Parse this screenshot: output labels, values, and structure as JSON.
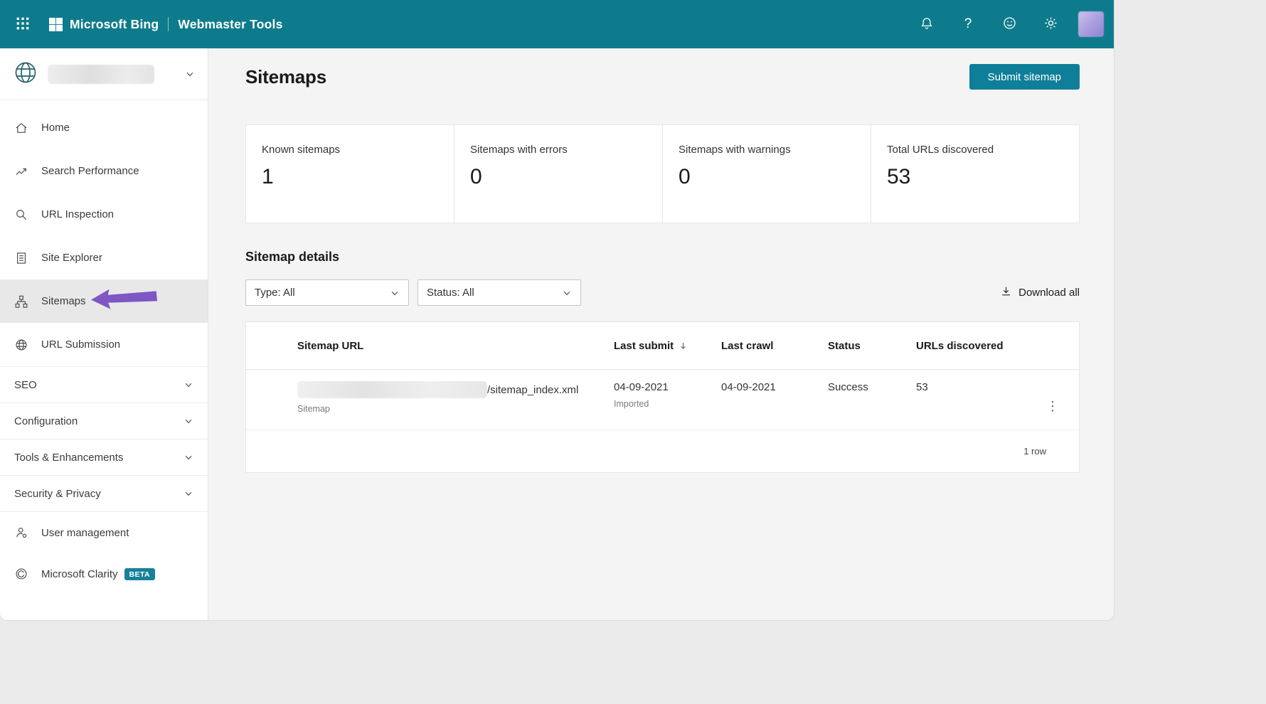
{
  "colors": {
    "accent": "#0e7b8c",
    "button": "#0f7f99",
    "badge": "#17809b",
    "arrow": "#7e57c5"
  },
  "topbar": {
    "brand": "Microsoft Bing",
    "product": "Webmaster Tools",
    "icons": {
      "help": "?"
    }
  },
  "sidebar": {
    "items": [
      {
        "label": "Home"
      },
      {
        "label": "Search Performance"
      },
      {
        "label": "URL Inspection"
      },
      {
        "label": "Site Explorer"
      },
      {
        "label": "Sitemaps",
        "selected": true
      },
      {
        "label": "URL Submission"
      },
      {
        "label": "SEO"
      },
      {
        "label": "Configuration"
      },
      {
        "label": "Tools & Enhancements"
      },
      {
        "label": "Security & Privacy"
      },
      {
        "label": "User management"
      },
      {
        "label": "Microsoft Clarity",
        "badge": "BETA"
      }
    ]
  },
  "main": {
    "title": "Sitemaps",
    "submit_button": "Submit sitemap",
    "stats": [
      {
        "label": "Known sitemaps",
        "value": "1"
      },
      {
        "label": "Sitemaps with errors",
        "value": "0"
      },
      {
        "label": "Sitemaps with warnings",
        "value": "0"
      },
      {
        "label": "Total URLs discovered",
        "value": "53"
      }
    ],
    "details_heading": "Sitemap details",
    "filters": [
      {
        "label": "Type: All"
      },
      {
        "label": "Status: All"
      }
    ],
    "download_all": "Download all",
    "table": {
      "columns": [
        "Sitemap URL",
        "Last submit",
        "Last crawl",
        "Status",
        "URLs discovered"
      ],
      "rows": [
        {
          "url": "/sitemap_index.xml",
          "url_type": "Sitemap",
          "last_submit": "04-09-2021",
          "last_submit_note": "Imported",
          "last_crawl": "04-09-2021",
          "status": "Success",
          "urls_discovered": "53"
        }
      ],
      "footer": "1 row",
      "menu_glyph": "⋮"
    }
  }
}
